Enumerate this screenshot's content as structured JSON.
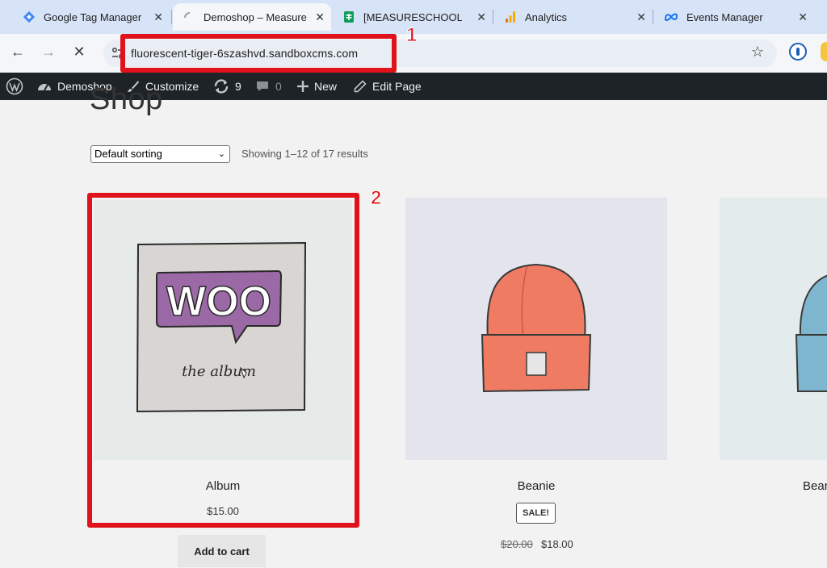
{
  "browser": {
    "tabs": [
      {
        "label": "Google Tag Manager",
        "icon": "google-tag-manager-icon",
        "active": false
      },
      {
        "label": "Demoshop – Measure",
        "icon": "loading-spinner-icon",
        "active": true
      },
      {
        "label": "[MEASURESCHOOL]",
        "icon": "google-sheets-icon",
        "active": false
      },
      {
        "label": "Analytics",
        "icon": "google-analytics-icon",
        "active": false
      },
      {
        "label": "Events Manager",
        "icon": "meta-icon",
        "active": false
      }
    ],
    "url": "fluorescent-tiger-6szashvd.sandboxcms.com"
  },
  "adminbar": {
    "site_name": "Demoshop",
    "customize": "Customize",
    "updates_count": "9",
    "comments_count": "0",
    "new_label": "New",
    "edit_label": "Edit Page"
  },
  "shop": {
    "title": "Shop",
    "sorting_selected": "Default sorting",
    "results_text": "Showing 1–12 of 17 results",
    "products": [
      {
        "name": "Album",
        "price": "$15.00",
        "button": "Add to cart"
      },
      {
        "name": "Beanie",
        "badge": "SALE!",
        "old_price": "$20.00",
        "price": "$18.00"
      },
      {
        "name": "Bear"
      }
    ],
    "album_art": {
      "logo_text": "WOO",
      "caption": "the album"
    }
  },
  "annotations": {
    "callout_1": "1",
    "callout_2": "2"
  },
  "colors": {
    "annotation_red": "#e0121b",
    "adminbar": "#1d2327",
    "tabbar": "#d7e3f7"
  }
}
